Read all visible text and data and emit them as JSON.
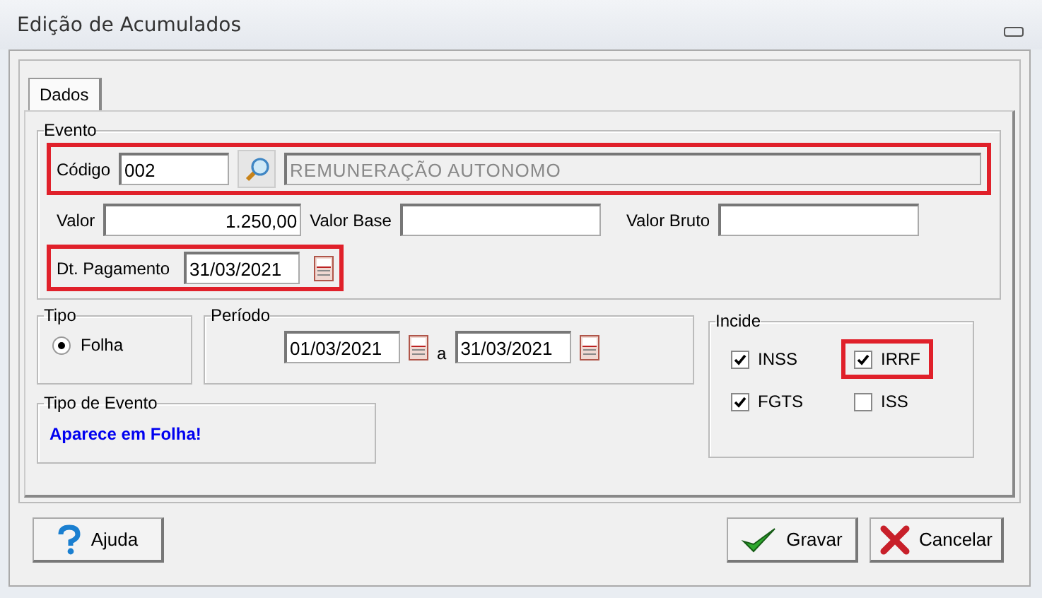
{
  "window": {
    "title": "Edição de Acumulados"
  },
  "tabs": [
    {
      "label": "Dados",
      "selected": true
    }
  ],
  "evento": {
    "legend": "Evento",
    "codigo": {
      "label": "Código",
      "value": "002",
      "description": "REMUNERAÇÃO AUTONOMO",
      "highlighted": true
    },
    "valor": {
      "label": "Valor",
      "value": "1.250,00"
    },
    "valor_base": {
      "label": "Valor Base"
    },
    "valor_bruto": {
      "label": "Valor Bruto"
    },
    "dt_pagamento": {
      "label": "Dt. Pagamento",
      "value": "31/03/2021",
      "highlighted": true
    }
  },
  "tipo": {
    "legend": "Tipo",
    "options": [
      {
        "label": "Folha",
        "selected": true
      }
    ]
  },
  "periodo": {
    "legend": "Período",
    "from": "01/03/2021",
    "separator": "a",
    "to": "31/03/2021"
  },
  "tipo_evento": {
    "legend": "Tipo de Evento",
    "text": "Aparece em Folha!"
  },
  "incide": {
    "legend": "Incide",
    "items": [
      {
        "label": "INSS",
        "checked": true,
        "highlighted": false
      },
      {
        "label": "IRRF",
        "checked": true,
        "highlighted": true
      },
      {
        "label": "FGTS",
        "checked": true,
        "highlighted": false
      },
      {
        "label": "ISS",
        "checked": false,
        "highlighted": false
      }
    ]
  },
  "buttons": [
    {
      "label": "Ajuda",
      "kind": "help"
    },
    {
      "label": "Gravar",
      "kind": "save"
    },
    {
      "label": "Cancelar",
      "kind": "cancel"
    }
  ]
}
